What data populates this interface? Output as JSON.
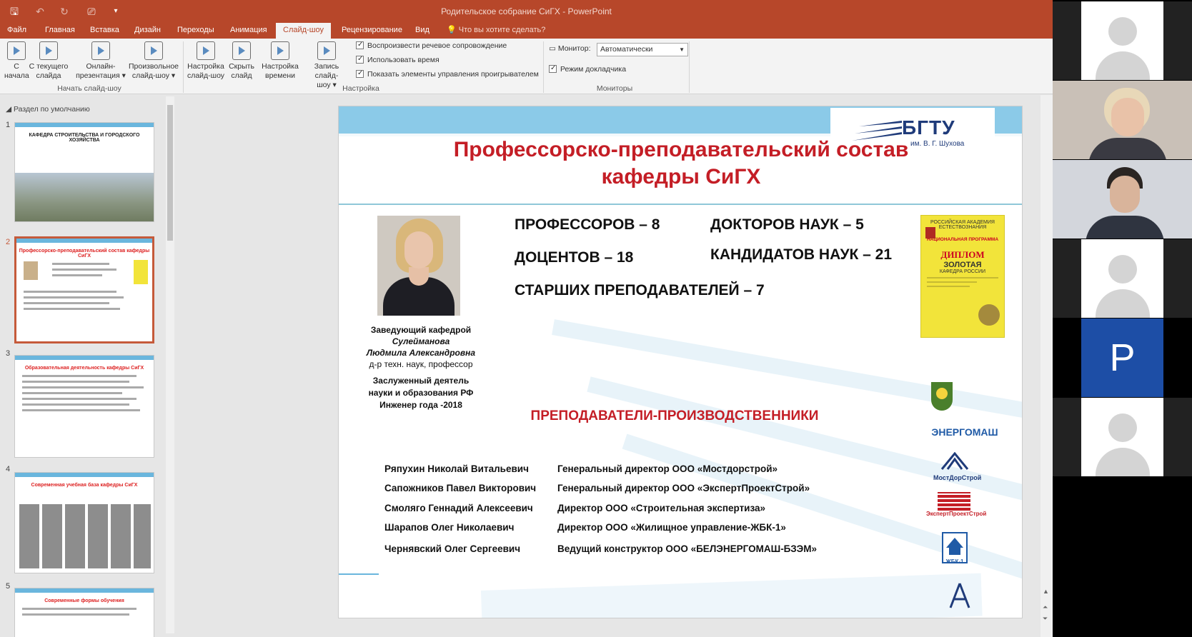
{
  "app": {
    "window_title": "Родительское собрание СиГХ - PowerPoint",
    "colors": {
      "accent": "#b7472a",
      "slide_title": "#c41e26"
    }
  },
  "tabs": [
    {
      "label": "Файл"
    },
    {
      "label": "Главная"
    },
    {
      "label": "Вставка"
    },
    {
      "label": "Дизайн"
    },
    {
      "label": "Переходы"
    },
    {
      "label": "Анимация"
    },
    {
      "label": "Слайд-шоу",
      "active": true
    },
    {
      "label": "Рецензирование"
    },
    {
      "label": "Вид"
    },
    {
      "label": "Что вы хотите сделать?"
    }
  ],
  "ribbon": {
    "buttons": [
      {
        "l1": "С",
        "l2": "начала"
      },
      {
        "l1": "С текущего",
        "l2": "слайда"
      },
      {
        "l1": "Онлайн-",
        "l2": "презентация ▾"
      },
      {
        "l1": "Произвольное",
        "l2": "слайд-шоу ▾"
      },
      {
        "l1": "Настройка",
        "l2": "слайд-шоу"
      },
      {
        "l1": "Скрыть",
        "l2": "слайд"
      },
      {
        "l1": "Настройка",
        "l2": "времени"
      },
      {
        "l1": "Запись слайд-",
        "l2": "шоу ▾"
      }
    ],
    "groups": {
      "start": "Начать слайд-шоу",
      "setup": "Настройка",
      "monitors": "Мониторы"
    },
    "checks": {
      "narration": "Воспроизвести речевое сопровождение",
      "timings": "Использовать время",
      "media_controls": "Показать элементы управления проигрывателем",
      "presenter": "Режим докладчика"
    },
    "monitor_label": "Монитор:",
    "monitor_value": "Автоматически"
  },
  "thumbnails": {
    "section": "Раздел по умолчанию",
    "slides": [
      {
        "num": "1",
        "title": "КАФЕДРА СТРОИТЕЛЬСТВА И ГОРОДСКОГО ХОЗЯЙСТВА"
      },
      {
        "num": "2",
        "title": "Профессорско-преподавательский состав кафедры СиГХ"
      },
      {
        "num": "3",
        "title": "Образовательная деятельность кафедры СиГХ"
      },
      {
        "num": "4",
        "title": "Современная учебная база кафедры СиГХ"
      },
      {
        "num": "5",
        "title": "Современные формы обучения"
      }
    ]
  },
  "slide": {
    "logo_text": "БГТУ",
    "logo_sub": "им. В. Г. Шухова",
    "title_line1": "Профессорско-преподавательский состав",
    "title_line2": "кафедры СиГХ",
    "stats": {
      "professors": "ПРОФЕССОРОВ – 8",
      "docents": "ДОЦЕНТОВ – 18",
      "senior": "СТАРШИХ ПРЕПОДАВАТЕЛЕЙ – 7",
      "doctors": "ДОКТОРОВ НАУК – 5",
      "candidates": "КАНДИДАТОВ НАУК – 21"
    },
    "head": {
      "role": "Заведующий кафедрой",
      "surname": "Сулейманова",
      "name": "Людмила Александровна",
      "degree": "д-р техн. наук, профессор",
      "award1": "Заслуженный деятель",
      "award2": "науки и образования РФ",
      "award3": "Инженер года -2018"
    },
    "diploma": {
      "top": "РОССИЙСКАЯ АКАДЕМИЯ ЕСТЕСТВОЗНАНИЯ",
      "program": "НАЦИОНАЛЬНАЯ ПРОГРАММА",
      "title": "ДИПЛОМ",
      "gold": "ЗОЛОТАЯ",
      "chair": "КАФЕДРА РОССИИ"
    },
    "subheading": "ПРЕПОДАВАТЕЛИ-ПРОИЗВОДСТВЕННИКИ",
    "staff": [
      {
        "name": "Ряпухин Николай Витальевич",
        "role": "Генеральный директор ООО «Мостдорстрой»"
      },
      {
        "name": "Сапожников Павел Викторович",
        "role": "Генеральный директор ООО «ЭкспертПроектСтрой»"
      },
      {
        "name": "Смоляго Геннадий Алексеевич",
        "role": "Директор ООО «Строительная экспертиза»"
      },
      {
        "name": "Шарапов Олег Николаевич",
        "role": "Директор ООО «Жилищное управление-ЖБК-1»"
      },
      {
        "name": "Чернявский Олег Сергеевич",
        "role": "Ведущий конструктор ООО «БЕЛЭНЕРГОМАШ-БЗЭМ»"
      }
    ],
    "brands": {
      "energomash": "ЭНЕРГОМАШ",
      "mostdor": "МостДорСтрой",
      "eps": "ЭкспертПроектСтрой",
      "zhbk": "ЖБК-1"
    }
  },
  "participants": {
    "p_letter": "P"
  }
}
